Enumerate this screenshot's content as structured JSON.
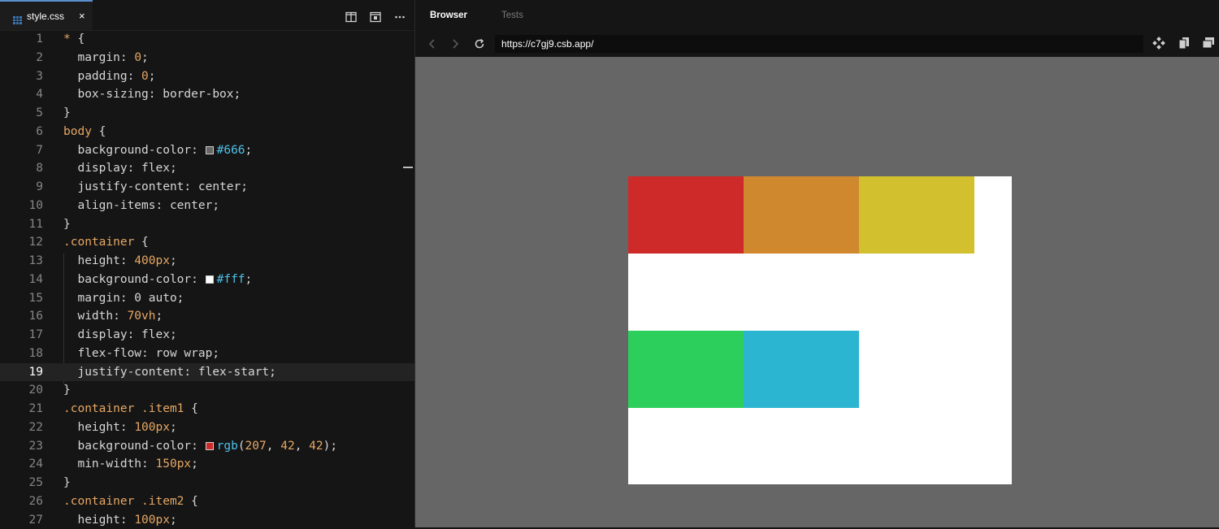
{
  "editor": {
    "tab_label": "style.css",
    "tab_close": "×",
    "lines": [
      {
        "n": "1",
        "tokens": [
          [
            "sel",
            "* "
          ],
          [
            "punc",
            "{"
          ]
        ]
      },
      {
        "n": "2",
        "tokens": [
          [
            "prop",
            "  margin: "
          ],
          [
            "num",
            "0"
          ],
          [
            "punc",
            ";"
          ]
        ]
      },
      {
        "n": "3",
        "tokens": [
          [
            "prop",
            "  padding: "
          ],
          [
            "num",
            "0"
          ],
          [
            "punc",
            ";"
          ]
        ]
      },
      {
        "n": "4",
        "tokens": [
          [
            "prop",
            "  box-sizing: border-box;"
          ]
        ]
      },
      {
        "n": "5",
        "tokens": [
          [
            "punc",
            "}"
          ]
        ]
      },
      {
        "n": "6",
        "tokens": [
          [
            "sel",
            "body "
          ],
          [
            "punc",
            "{"
          ]
        ]
      },
      {
        "n": "7",
        "tokens": [
          [
            "prop",
            "  background-color: "
          ],
          [
            "swatch",
            "#666666"
          ],
          [
            "col",
            "#666"
          ],
          [
            "punc",
            ";"
          ]
        ]
      },
      {
        "n": "8",
        "tokens": [
          [
            "prop",
            "  display: flex;"
          ]
        ]
      },
      {
        "n": "9",
        "tokens": [
          [
            "prop",
            "  justify-content: center;"
          ]
        ]
      },
      {
        "n": "10",
        "tokens": [
          [
            "prop",
            "  align-items: center;"
          ]
        ]
      },
      {
        "n": "11",
        "tokens": [
          [
            "punc",
            "}"
          ]
        ]
      },
      {
        "n": "12",
        "tokens": [
          [
            "sel",
            ".container "
          ],
          [
            "punc",
            "{"
          ]
        ]
      },
      {
        "n": "13",
        "tokens": [
          [
            "prop",
            "  height: "
          ],
          [
            "num",
            "400px"
          ],
          [
            "punc",
            ";"
          ]
        ]
      },
      {
        "n": "14",
        "tokens": [
          [
            "prop",
            "  background-color: "
          ],
          [
            "swatch",
            "#ffffff"
          ],
          [
            "col",
            "#fff"
          ],
          [
            "punc",
            ";"
          ]
        ]
      },
      {
        "n": "15",
        "tokens": [
          [
            "prop",
            "  margin: 0 auto;"
          ]
        ]
      },
      {
        "n": "16",
        "tokens": [
          [
            "prop",
            "  width: "
          ],
          [
            "num",
            "70vh"
          ],
          [
            "punc",
            ";"
          ]
        ]
      },
      {
        "n": "17",
        "tokens": [
          [
            "prop",
            "  display: flex;"
          ]
        ]
      },
      {
        "n": "18",
        "tokens": [
          [
            "prop",
            "  flex-flow: row wrap;"
          ]
        ]
      },
      {
        "n": "19",
        "tokens": [
          [
            "prop",
            "  justify-content: flex-start;"
          ]
        ]
      },
      {
        "n": "20",
        "tokens": [
          [
            "punc",
            "}"
          ]
        ]
      },
      {
        "n": "21",
        "tokens": [
          [
            "sel",
            ".container .item1 "
          ],
          [
            "punc",
            "{"
          ]
        ]
      },
      {
        "n": "22",
        "tokens": [
          [
            "prop",
            "  height: "
          ],
          [
            "num",
            "100px"
          ],
          [
            "punc",
            ";"
          ]
        ]
      },
      {
        "n": "23",
        "tokens": [
          [
            "prop",
            "  background-color: "
          ],
          [
            "swatch",
            "#cf2a2a"
          ],
          [
            "col",
            "rgb"
          ],
          [
            "punc",
            "("
          ],
          [
            "num",
            "207"
          ],
          [
            "punc",
            ", "
          ],
          [
            "num",
            "42"
          ],
          [
            "punc",
            ", "
          ],
          [
            "num",
            "42"
          ],
          [
            "punc",
            ");"
          ]
        ]
      },
      {
        "n": "24",
        "tokens": [
          [
            "prop",
            "  min-width: "
          ],
          [
            "num",
            "150px"
          ],
          [
            "punc",
            ";"
          ]
        ]
      },
      {
        "n": "25",
        "tokens": [
          [
            "punc",
            "}"
          ]
        ]
      },
      {
        "n": "26",
        "tokens": [
          [
            "sel",
            ".container .item2 "
          ],
          [
            "punc",
            "{"
          ]
        ]
      },
      {
        "n": "27",
        "tokens": [
          [
            "prop",
            "  height: "
          ],
          [
            "num",
            "100px"
          ],
          [
            "punc",
            ";"
          ]
        ]
      }
    ],
    "active_line": "19"
  },
  "browser": {
    "tab_browser": "Browser",
    "tab_tests": "Tests",
    "url": "https://c7gj9.csb.app/",
    "page_background": "#666666",
    "container_background": "#ffffff",
    "items": [
      {
        "name": "item1",
        "color": "#cf2a2a"
      },
      {
        "name": "item2",
        "color": "#d0882e"
      },
      {
        "name": "item3",
        "color": "#d2c02e"
      },
      {
        "name": "item4",
        "color": "#2ccf5b"
      },
      {
        "name": "item5",
        "color": "#2bb5d0"
      }
    ]
  }
}
